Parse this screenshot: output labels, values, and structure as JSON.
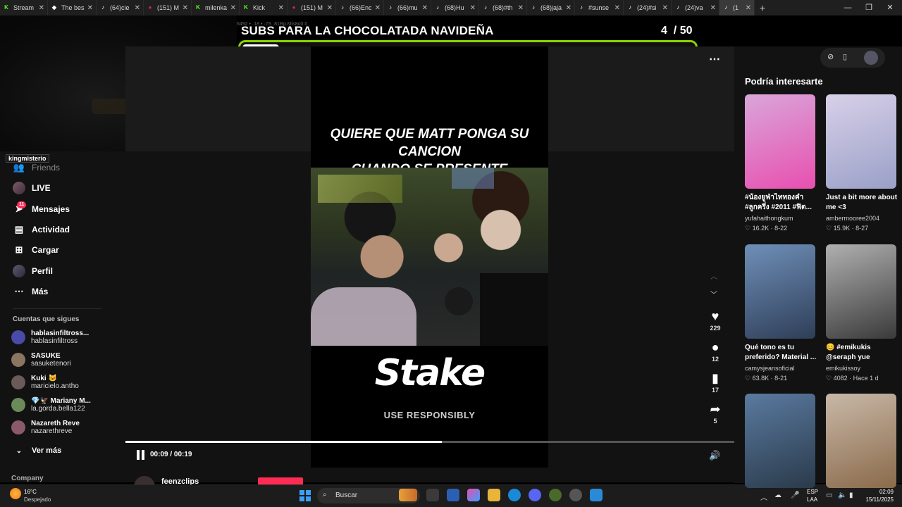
{
  "browser": {
    "tabs": [
      {
        "label": "Stream",
        "favicon": "kick-icon",
        "color": "#53fc18",
        "glyph": "K"
      },
      {
        "label": "The bes",
        "favicon": "diamond-icon",
        "color": "#ffffff",
        "glyph": "◆"
      },
      {
        "label": "(64)cie",
        "favicon": "tiktok-icon",
        "color": "#ffffff",
        "glyph": "♪"
      },
      {
        "label": "(151) M",
        "favicon": "record-icon",
        "color": "#e01e5a",
        "glyph": "●"
      },
      {
        "label": "milenka",
        "favicon": "kick-icon",
        "color": "#53fc18",
        "glyph": "K"
      },
      {
        "label": "Kick",
        "favicon": "kick-icon",
        "color": "#53fc18",
        "glyph": "K"
      },
      {
        "label": "(151) M",
        "favicon": "record-icon",
        "color": "#e01e5a",
        "glyph": "●"
      },
      {
        "label": "(66)Enc",
        "favicon": "tiktok-icon",
        "color": "#ffffff",
        "glyph": "♪"
      },
      {
        "label": "(66)mu",
        "favicon": "tiktok-icon",
        "color": "#ffffff",
        "glyph": "♪"
      },
      {
        "label": "(68)Hu",
        "favicon": "tiktok-icon",
        "color": "#ffffff",
        "glyph": "♪"
      },
      {
        "label": "(68)#th",
        "favicon": "tiktok-icon",
        "color": "#ffffff",
        "glyph": "♪"
      },
      {
        "label": "(68)jaja",
        "favicon": "tiktok-icon",
        "color": "#ffffff",
        "glyph": "♪"
      },
      {
        "label": "#sunse",
        "favicon": "tiktok-icon",
        "color": "#ffffff",
        "glyph": "♪"
      },
      {
        "label": "(24)#si",
        "favicon": "tiktok-icon",
        "color": "#ffffff",
        "glyph": "♪"
      },
      {
        "label": "(24)va",
        "favicon": "tiktok-icon",
        "color": "#ffffff",
        "glyph": "♪"
      },
      {
        "label": "(1",
        "favicon": "tiktok-icon",
        "color": "#ffffff",
        "glyph": "♪",
        "active": true
      }
    ],
    "new_tab": "+",
    "window_controls": [
      "—",
      "❐",
      "✕"
    ]
  },
  "overlay": {
    "title": "SUBS PARA LA CHOCOLATADA NAVIDEÑA",
    "count": "4",
    "goal": "/ 50",
    "progress": 0.08,
    "accent_color": "#8dd400",
    "streamer_name": "kingmisterio",
    "tiny_text": "6492 • ·18 • ·7S .81Rp.Mis8o0.0"
  },
  "sidebar": {
    "items": [
      {
        "label": "Friends",
        "icon": "friends-icon"
      },
      {
        "label": "LIVE",
        "icon": "live-avatar"
      },
      {
        "label": "Mensajes",
        "icon": "send-icon",
        "badge": "11"
      },
      {
        "label": "Actividad",
        "icon": "activity-icon"
      },
      {
        "label": "Cargar",
        "icon": "upload-icon"
      },
      {
        "label": "Perfil",
        "icon": "profile-avatar"
      },
      {
        "label": "Más",
        "icon": "more-icon"
      }
    ],
    "following_heading": "Cuentas que sigues",
    "following": [
      {
        "name": "hablasinfiltross...",
        "handle": "hablasinfiltross",
        "color": "#4a4aa8"
      },
      {
        "name": "SASUKE",
        "handle": "sasuketenori",
        "color": "#8a7560"
      },
      {
        "name": "Kuki 🐱",
        "handle": "maricielo.antho",
        "color": "#6a5a5a"
      },
      {
        "name": "💎🦅 Mariany M...",
        "handle": "la.gorda.bella122",
        "color": "#6a8a5a"
      },
      {
        "name": "Nazareth Reve",
        "handle": "nazarethreve",
        "color": "#8a5a6a"
      }
    ],
    "see_more": "Ver más",
    "company": "Company"
  },
  "video": {
    "caption_line1": "QUIERE QUE MATT PONGA SU CANCION",
    "caption_line2": "CUANDO SE PRESENTE",
    "sponsor": "Stake",
    "sponsor_sub": "USE RESPONSIBLY",
    "time": "00:09 / 00:19",
    "progress": 0.52,
    "author": "feenzclips",
    "actions": [
      {
        "icon": "heart-icon",
        "glyph": "♥",
        "count": "229"
      },
      {
        "icon": "comment-icon",
        "glyph": "●",
        "count": "12"
      },
      {
        "icon": "bookmark-icon",
        "glyph": "▮",
        "count": "17"
      },
      {
        "icon": "share-icon",
        "glyph": "➦",
        "count": "5"
      }
    ]
  },
  "recommendations": {
    "heading": "Podría interesarte",
    "cards": [
      {
        "title": "#น้องยูฟ่าไททองคำ #ลูกครึ่ง #2011 #ฟิต...",
        "author": "yufahaithongkum",
        "likes": "16.2K",
        "date": "8-22",
        "colors": [
          "#d9a6d9",
          "#e84fb0"
        ]
      },
      {
        "title": "Just a bit more about me <3",
        "author": "ambermooree2004",
        "likes": "15.9K",
        "date": "8-27",
        "colors": [
          "#d8d0e8",
          "#9aa0c8"
        ]
      },
      {
        "title": "Qué tono es tu preferido? Material ...",
        "author": "camysjeansoficial",
        "likes": "63.8K",
        "date": "8-21",
        "colors": [
          "#6f8fb8",
          "#2e3e58"
        ]
      },
      {
        "title": "😊 #emikukis @seraph yue",
        "author": "emikukissoy",
        "likes": "4082",
        "date": "Hace 1 d",
        "colors": [
          "#b0b0b0",
          "#3a3a3a"
        ]
      },
      {
        "title": "",
        "author": "",
        "likes": "",
        "date": "",
        "colors": [
          "#5a7aa0",
          "#2a3a4a"
        ]
      },
      {
        "title": "",
        "author": "",
        "likes": "",
        "date": "",
        "colors": [
          "#c8b8a8",
          "#8a6a4a"
        ]
      }
    ]
  },
  "taskbar": {
    "weather_temp": "16°C",
    "weather_desc": "Despejado",
    "search_placeholder": "Buscar",
    "lang1": "ESP",
    "lang2": "LAA",
    "time": "02:09",
    "date": "15/11/2025"
  }
}
